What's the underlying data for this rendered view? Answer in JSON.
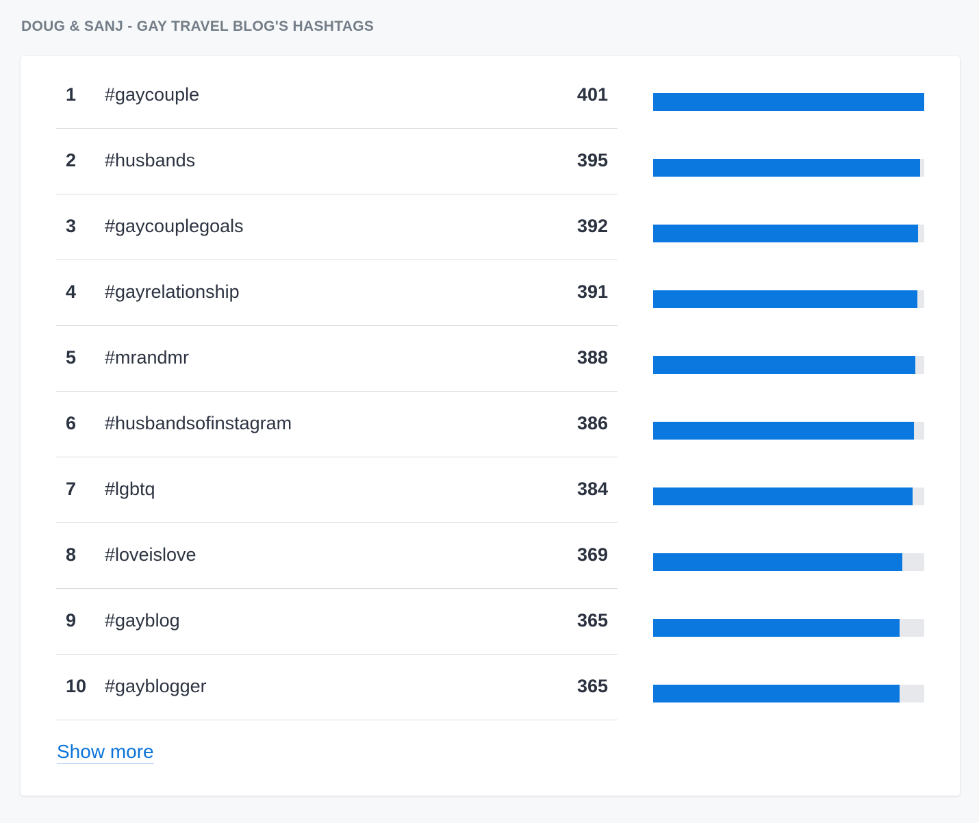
{
  "section": {
    "title": "DOUG & SANJ - GAY TRAVEL BLOG'S HASHTAGS"
  },
  "hashtags": [
    {
      "rank": "1",
      "tag": "#gaycouple",
      "count": "401",
      "value": 401
    },
    {
      "rank": "2",
      "tag": "#husbands",
      "count": "395",
      "value": 395
    },
    {
      "rank": "3",
      "tag": "#gaycouplegoals",
      "count": "392",
      "value": 392
    },
    {
      "rank": "4",
      "tag": "#gayrelationship",
      "count": "391",
      "value": 391
    },
    {
      "rank": "5",
      "tag": "#mrandmr",
      "count": "388",
      "value": 388
    },
    {
      "rank": "6",
      "tag": "#husbandsofinstagram",
      "count": "386",
      "value": 386
    },
    {
      "rank": "7",
      "tag": "#lgbtq",
      "count": "384",
      "value": 384
    },
    {
      "rank": "8",
      "tag": "#loveislove",
      "count": "369",
      "value": 369
    },
    {
      "rank": "9",
      "tag": "#gayblog",
      "count": "365",
      "value": 365
    },
    {
      "rank": "10",
      "tag": "#gayblogger",
      "count": "365",
      "value": 365
    }
  ],
  "bar_max": 401,
  "actions": {
    "show_more_label": "Show more"
  },
  "colors": {
    "bar_fill": "#0b78e0",
    "bar_track": "#e6e8eb",
    "link": "#0b73d8",
    "title": "#737d88"
  }
}
